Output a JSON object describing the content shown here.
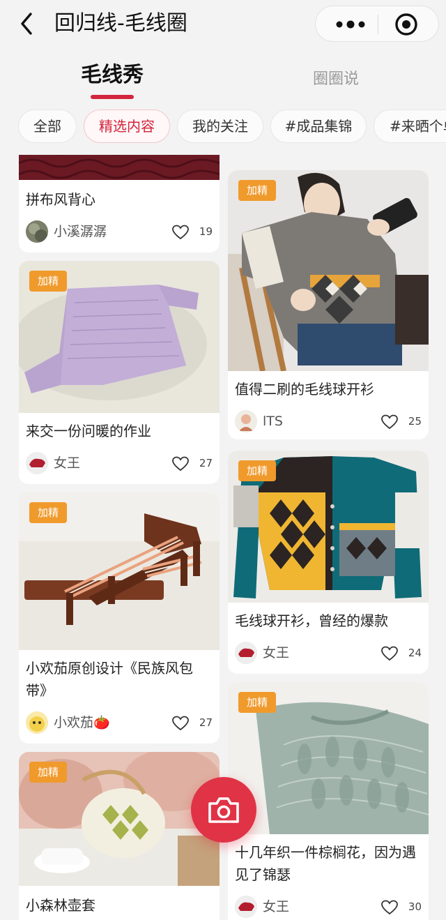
{
  "nav": {
    "title": "回归线-毛线圈"
  },
  "tabs": [
    {
      "label": "毛线秀",
      "active": true
    },
    {
      "label": "圈圈说",
      "active": false
    }
  ],
  "chips": [
    {
      "label": "全部"
    },
    {
      "label": "精选内容",
      "active": true
    },
    {
      "label": "我的关注"
    },
    {
      "label": "#成品集锦"
    },
    {
      "label": "#来晒个单"
    }
  ],
  "badge_label": "加精",
  "colors": {
    "accent": "#d3253c",
    "badge": "#f09a2c",
    "fab": "#e03346"
  },
  "left_cards": [
    {
      "title": "拼布风背心",
      "author": "小溪潺潺",
      "likes": "19",
      "badge": false
    },
    {
      "title": "来交一份问暖的作业",
      "author": "女王",
      "likes": "27",
      "badge": true
    },
    {
      "title": "小欢茄原创设计《民族风包带》",
      "author": "小欢茄🍅",
      "likes": "27",
      "badge": true
    },
    {
      "title": "小森林壶套",
      "badge": true
    }
  ],
  "right_cards": [
    {
      "title": "值得二刷的毛线球开衫",
      "author": "lTS",
      "likes": "25",
      "badge": true
    },
    {
      "title": "毛线球开衫，曾经的爆款",
      "author": "女王",
      "likes": "24",
      "badge": true
    },
    {
      "title": "十几年织一件棕榈花，因为遇见了锦瑟",
      "author": "女王",
      "likes": "30",
      "badge": true
    }
  ],
  "icons": {
    "back": "chevron-left-icon",
    "more": "more-dots-icon",
    "close": "target-close-icon",
    "like": "heart-icon",
    "camera": "camera-icon"
  }
}
